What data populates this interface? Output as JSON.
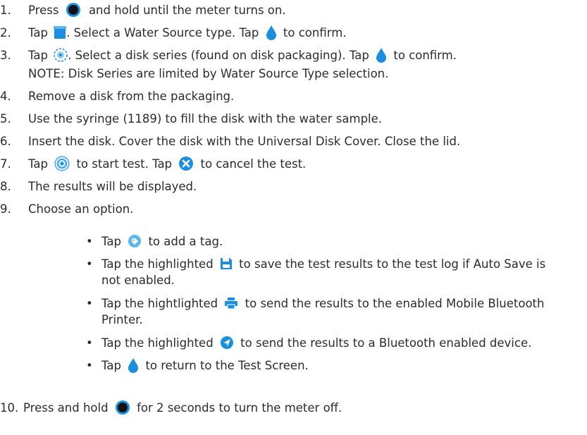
{
  "steps": [
    {
      "num": "1.",
      "a": "Press",
      "b": "and hold until the meter turns on."
    },
    {
      "num": "2.",
      "a": "Tap",
      "b": ". Select a Water Source type. Tap",
      "c": "to confirm."
    },
    {
      "num": "3.",
      "a": "Tap",
      "b": ". Select a disk series (found on disk packaging). Tap",
      "c": "to confirm."
    },
    {
      "note": "NOTE: Disk Series are limited by Water Source Type selection."
    },
    {
      "num": "4.",
      "a": "Remove a disk from the packaging."
    },
    {
      "num": "5.",
      "a": "Use the syringe (1189) to fill the disk with the water sample."
    },
    {
      "num": "6.",
      "a": "Insert the disk. Cover the disk with the Universal Disk Cover. Close the lid."
    },
    {
      "num": "7.",
      "a": "Tap",
      "b": "to start test. Tap",
      "c": "to cancel the test."
    },
    {
      "num": "8.",
      "a": "The results will be displayed."
    },
    {
      "num": "9.",
      "a": "Choose an option."
    }
  ],
  "options": [
    {
      "a": "Tap",
      "b": "to add a tag."
    },
    {
      "a": "Tap the highlighted",
      "b": "to save the test results to the test log if Auto Save is",
      "b2": "not enabled."
    },
    {
      "a": "Tap the hightlighted",
      "b": "to send the results to the enabled Mobile Bluetooth",
      "b2": "Printer."
    },
    {
      "a": "Tap the highlighted",
      "b": "to send the results to a Bluetooth enabled device."
    },
    {
      "a": "Tap",
      "b": "to return to the Test Screen."
    }
  ],
  "final": {
    "num": "10.",
    "a": "Press and hold",
    "b": "for 2 seconds to turn the meter off."
  },
  "bullet_char": "•",
  "colors": {
    "text": "#2b2b2b",
    "accent": "#1a8fe0"
  }
}
